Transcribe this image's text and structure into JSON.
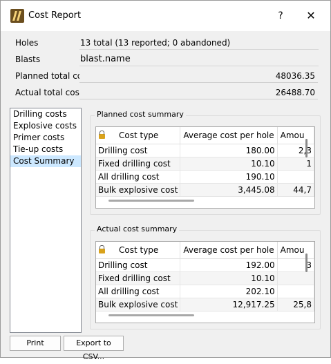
{
  "window": {
    "title": "Cost Report",
    "help_label": "?",
    "close_label": "✕",
    "icon": "app-logo-icon"
  },
  "info": {
    "holes_label": "Holes",
    "holes_value": "13 total (13 reported; 0 abandoned)",
    "blasts_label": "Blasts",
    "blasts_value": "blast.name",
    "planned_label": "Planned total cost",
    "planned_value": "48036.35",
    "actual_label": "Actual total cost",
    "actual_value": "26488.70"
  },
  "sidebar": {
    "items": [
      {
        "label": "Drilling costs"
      },
      {
        "label": "Explosive costs"
      },
      {
        "label": "Primer costs"
      },
      {
        "label": "Tie-up costs"
      },
      {
        "label": "Cost Summary",
        "selected": true
      }
    ]
  },
  "planned": {
    "title": "Planned cost summary",
    "headers": [
      "Cost type",
      "Average cost per hole",
      "Amou"
    ],
    "rows": [
      [
        "Drilling cost",
        "180.00",
        "2,3"
      ],
      [
        "Fixed drilling cost",
        "10.10",
        "1"
      ],
      [
        "All drilling cost",
        "190.10",
        ""
      ],
      [
        "Bulk explosive cost",
        "3,445.08",
        "44,7"
      ]
    ]
  },
  "actual": {
    "title": "Actual cost summary",
    "headers": [
      "Cost type",
      "Average cost per hole",
      "Amou"
    ],
    "rows": [
      [
        "Drilling cost",
        "192.00",
        "3"
      ],
      [
        "Fixed drilling cost",
        "10.10",
        ""
      ],
      [
        "All drilling cost",
        "202.10",
        ""
      ],
      [
        "Bulk explosive cost",
        "12,917.25",
        "25,8"
      ]
    ]
  },
  "buttons": {
    "print": "Print",
    "export": "Export to CSV..."
  }
}
